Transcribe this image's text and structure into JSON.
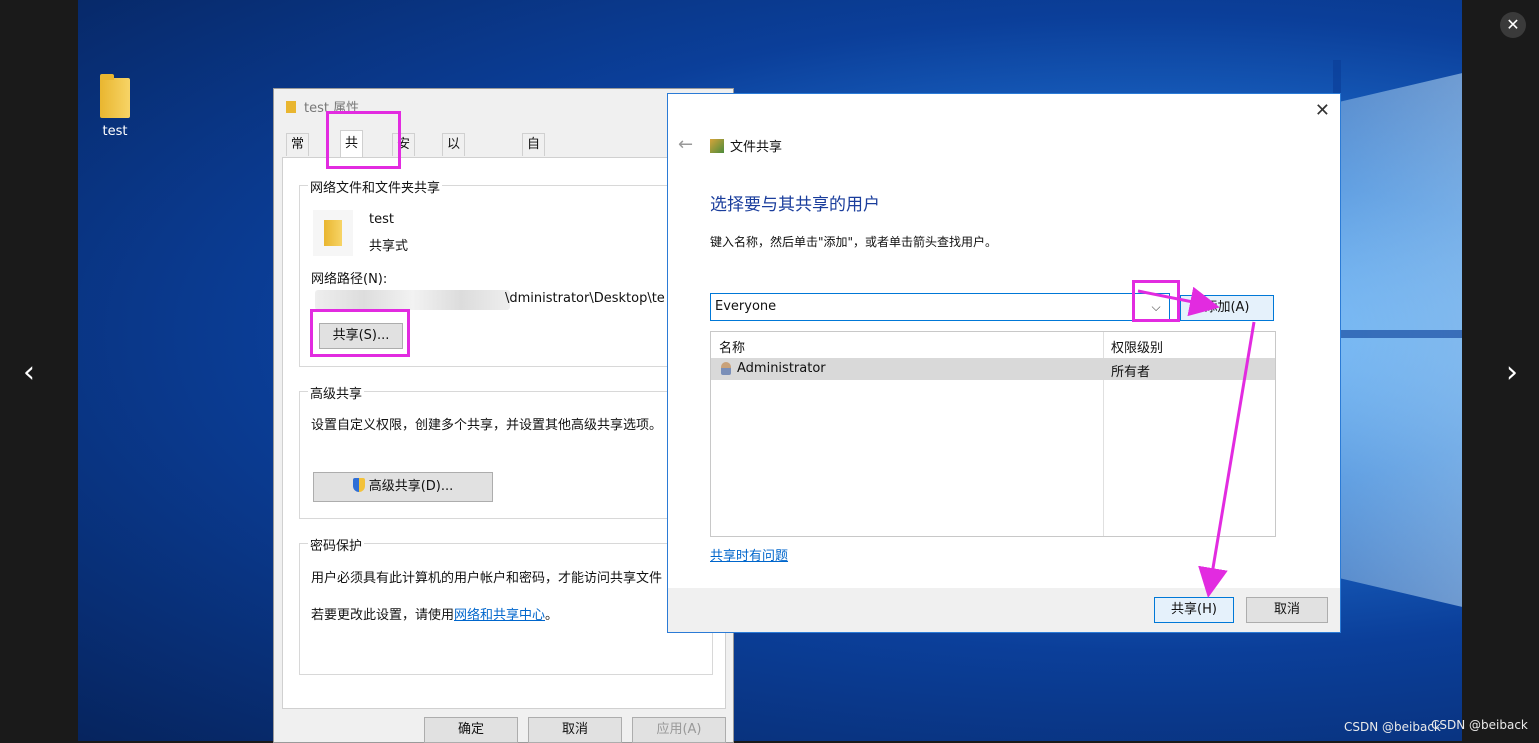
{
  "viewer": {
    "prev_glyph": "‹",
    "next_glyph": "›",
    "close_glyph": "✕",
    "watermark": "CSDN @beiback",
    "watermark2": "CSDN @beiback"
  },
  "desktop": {
    "icon_label": "test"
  },
  "props_dialog": {
    "title": "test 属性",
    "tabs": [
      "常规",
      "共享",
      "安全",
      "以前的版本",
      "自定义"
    ],
    "network_group": "网络文件和文件夹共享",
    "folder_name": "test",
    "folder_status": "共享式",
    "network_path_label": "网络路径(N):",
    "network_path_value": "\\dministrator\\Desktop\\te",
    "share_button": "共享(S)...",
    "advanced_group": "高级共享",
    "advanced_desc": "设置自定义权限，创建多个共享，并设置其他高级共享选项。",
    "advanced_button": "高级共享(D)...",
    "password_group": "密码保护",
    "password_desc": "用户必须具有此计算机的用户帐户和密码，才能访问共享文件",
    "password_change_prefix": "若要更改此设置，请使用",
    "password_link": "网络和共享中心",
    "password_change_suffix": "。",
    "ok": "确定",
    "cancel": "取消",
    "apply": "应用(A)"
  },
  "share_dialog": {
    "close_glyph": "✕",
    "back_glyph": "←",
    "window_title": "文件共享",
    "heading": "选择要与其共享的用户",
    "instruction": "键入名称，然后单击\"添加\"，或者单击箭头查找用户。",
    "input_value": "Everyone",
    "dropdown_glyph": "⌵",
    "add_button": "添加(A)",
    "columns": [
      "名称",
      "权限级别"
    ],
    "rows": [
      {
        "name": "Administrator",
        "level": "所有者"
      }
    ],
    "help_link": "共享时有问题",
    "share_button": "共享(H)",
    "cancel_button": "取消"
  },
  "colors": {
    "highlight": "#e22be0",
    "accent": "#0078d7",
    "heading": "#1a3d9c"
  }
}
